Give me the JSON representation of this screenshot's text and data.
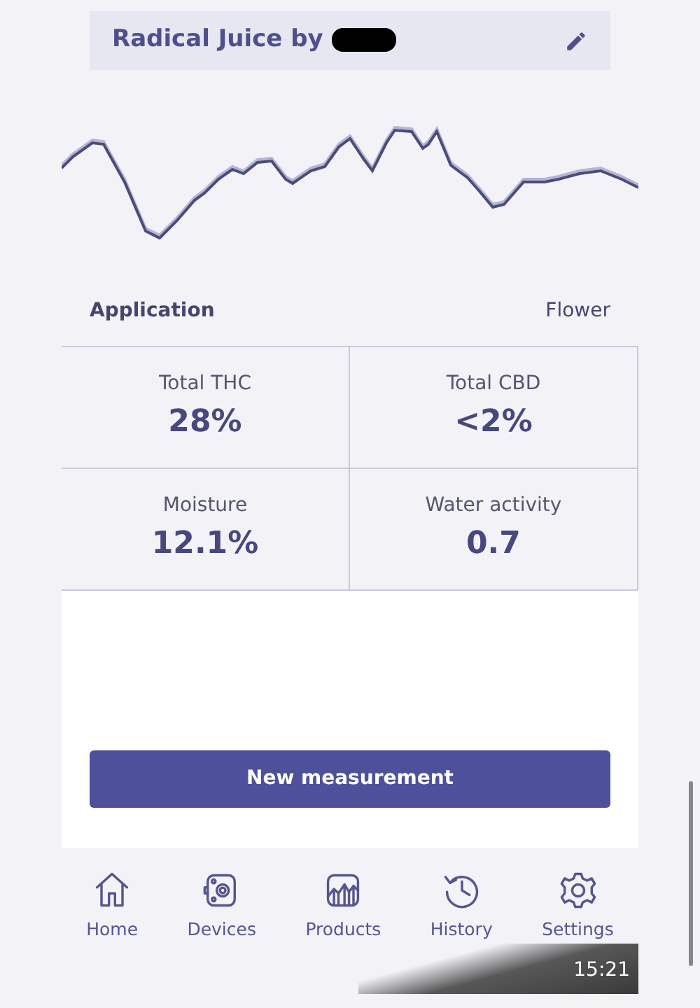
{
  "product": {
    "title": "Radical Juice by"
  },
  "application": {
    "label": "Application",
    "value": "Flower"
  },
  "metrics": [
    {
      "label": "Total THC",
      "value": "28%"
    },
    {
      "label": "Total CBD",
      "value": "<2%"
    },
    {
      "label": "Moisture",
      "value": "12.1%"
    },
    {
      "label": "Water activity",
      "value": "0.7"
    }
  ],
  "action_button": "New measurement",
  "nav": [
    {
      "kind": "home",
      "label": "Home"
    },
    {
      "kind": "devices",
      "label": "Devices"
    },
    {
      "kind": "products",
      "label": "Products"
    },
    {
      "kind": "history",
      "label": "History"
    },
    {
      "kind": "settings",
      "label": "Settings"
    }
  ],
  "overlay_time": "15:21"
}
